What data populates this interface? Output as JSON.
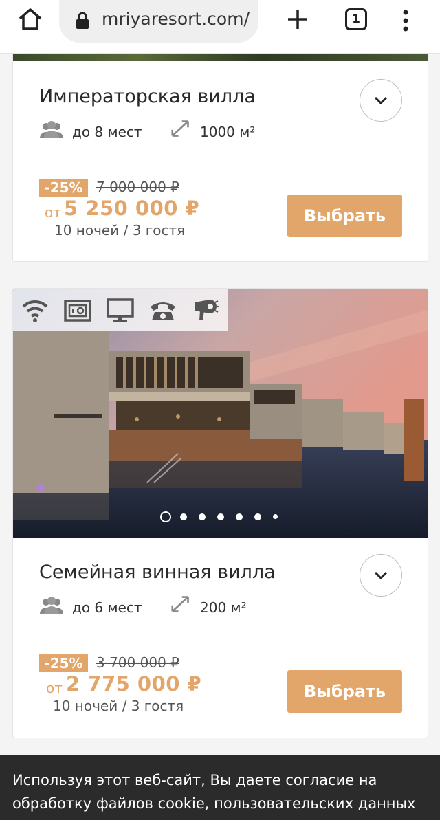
{
  "browser": {
    "url": "mriyaresort.com/",
    "tab_count": "1"
  },
  "rooms": [
    {
      "title": "Императорская вилла",
      "capacity": "до 8 мест",
      "area": "1000 м²",
      "discount": "-25%",
      "old_price": "7 000 000 ₽",
      "from_label": "от",
      "price": "5 250 000 ₽",
      "nights": "10 ночей / 3 гостя",
      "select_label": "Выбрать"
    },
    {
      "title": "Семейная винная вилла",
      "capacity": "до 6 мест",
      "area": "200 м²",
      "discount": "-25%",
      "old_price": "3 700 000 ₽",
      "from_label": "от",
      "price": "2 775 000 ₽",
      "nights": "10 ночей / 3 гостя",
      "select_label": "Выбрать",
      "amenities": [
        "wifi-icon",
        "safe-icon",
        "tv-icon",
        "phone-icon",
        "hairdryer-icon"
      ],
      "carousel": {
        "slides": 7,
        "active": 1
      }
    }
  ],
  "cookie_banner": {
    "text": "Используя этот веб-сайт, Вы даете согласие на обработку файлов cookie, пользовательских данных"
  },
  "colors": {
    "accent": "#e2a56a",
    "banner_bg": "#2b2b2b"
  }
}
